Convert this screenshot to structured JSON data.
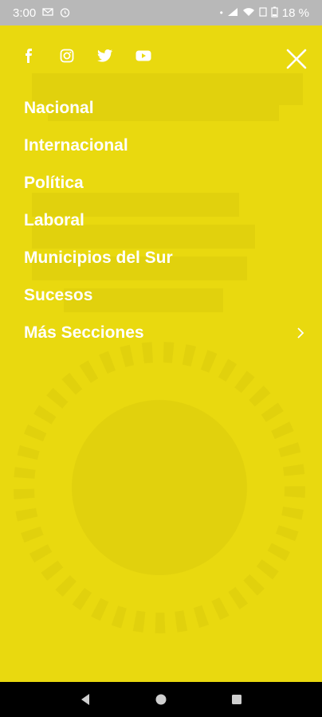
{
  "status_bar": {
    "time": "3:00",
    "battery": "18 %",
    "icons": [
      "mail-icon",
      "alarm-icon",
      "dot-icon",
      "signal-icon",
      "wifi-icon",
      "lte-icon",
      "battery-icon"
    ]
  },
  "social": {
    "icons": [
      "facebook-icon",
      "instagram-icon",
      "twitter-icon",
      "youtube-icon"
    ]
  },
  "menu": {
    "items": [
      {
        "label": "Nacional"
      },
      {
        "label": "Internacional"
      },
      {
        "label": "Política"
      },
      {
        "label": "Laboral"
      },
      {
        "label": "Municipios del Sur"
      },
      {
        "label": "Sucesos"
      },
      {
        "label": "Más Secciones"
      }
    ]
  },
  "colors": {
    "drawer_bg": "#e9d90f",
    "text": "#ffffff",
    "status_bar_bg": "#b8b8b8",
    "nav_bar_bg": "#000000"
  }
}
